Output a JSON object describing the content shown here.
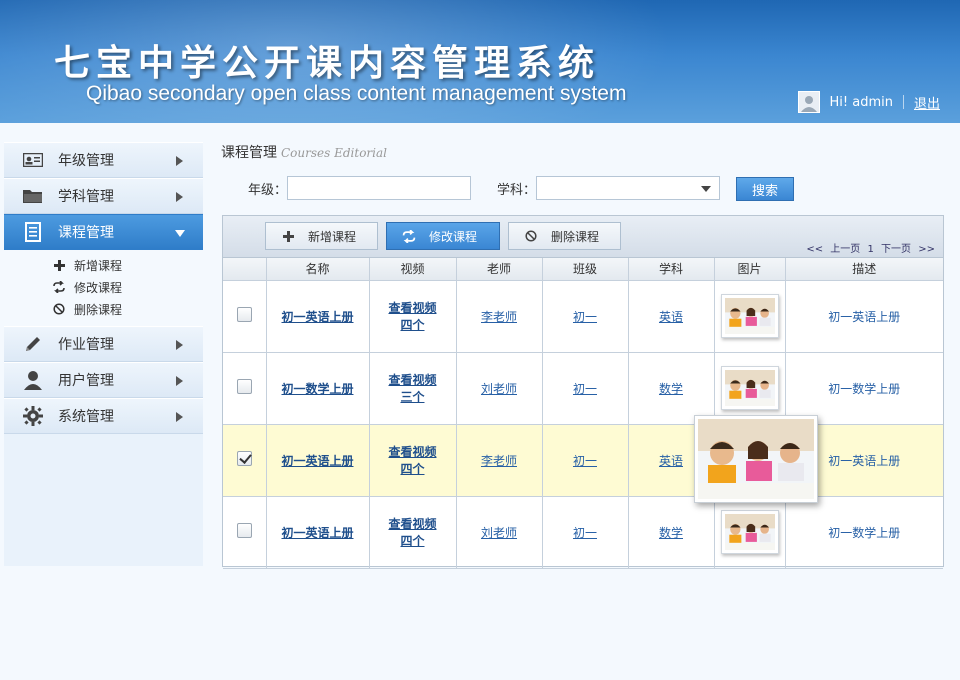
{
  "header": {
    "title_cn": "七宝中学公开课内容管理系统",
    "title_en": "Qibao secondary open class content management system",
    "greeting": "Hi! admin",
    "logout": "退出"
  },
  "sidebar": {
    "items": [
      {
        "label": "年级管理",
        "icon": "id-card-icon"
      },
      {
        "label": "学科管理",
        "icon": "folder-icon"
      },
      {
        "label": "课程管理",
        "icon": "document-icon"
      },
      {
        "label": "作业管理",
        "icon": "pencil-icon"
      },
      {
        "label": "用户管理",
        "icon": "user-icon"
      },
      {
        "label": "系统管理",
        "icon": "gear-icon"
      }
    ],
    "sub_items": [
      {
        "label": "新增课程",
        "icon": "plus-icon"
      },
      {
        "label": "修改课程",
        "icon": "refresh-icon"
      },
      {
        "label": "删除课程",
        "icon": "ban-icon"
      }
    ]
  },
  "main": {
    "title": "课程管理",
    "title_en": "Courses Editorial",
    "filter": {
      "grade_label": "年级：",
      "grade_value": "",
      "subject_label": "学科：",
      "subject_value": "",
      "search_button": "搜索"
    },
    "toolbar": {
      "add": "新增课程",
      "edit": "修改课程",
      "delete": "删除课程"
    },
    "pager": {
      "prev_all": "<<",
      "prev": "上一页",
      "page": "1",
      "next": "下一页",
      "next_all": ">>"
    },
    "table": {
      "headers": [
        "名称",
        "视频",
        "老师",
        "班级",
        "学科",
        "图片",
        "描述"
      ],
      "rows": [
        {
          "checked": false,
          "name": "初一英语上册",
          "video_1": "查看视频",
          "video_2": "四个",
          "teacher": "李老师",
          "class": "初一",
          "subject": "英语",
          "desc": "初一英语上册"
        },
        {
          "checked": false,
          "name": "初一数学上册",
          "video_1": "查看视频",
          "video_2": "三个",
          "teacher": "刘老师",
          "class": "初一",
          "subject": "数学",
          "desc": "初一数学上册"
        },
        {
          "checked": true,
          "name": "初一英语上册",
          "video_1": "查看视频",
          "video_2": "四个",
          "teacher": "李老师",
          "class": "初一",
          "subject": "英语",
          "desc": "初一英语上册"
        },
        {
          "checked": false,
          "name": "初一英语上册",
          "video_1": "查看视频",
          "video_2": "四个",
          "teacher": "刘老师",
          "class": "初一",
          "subject": "数学",
          "desc": "初一数学上册"
        }
      ]
    }
  }
}
